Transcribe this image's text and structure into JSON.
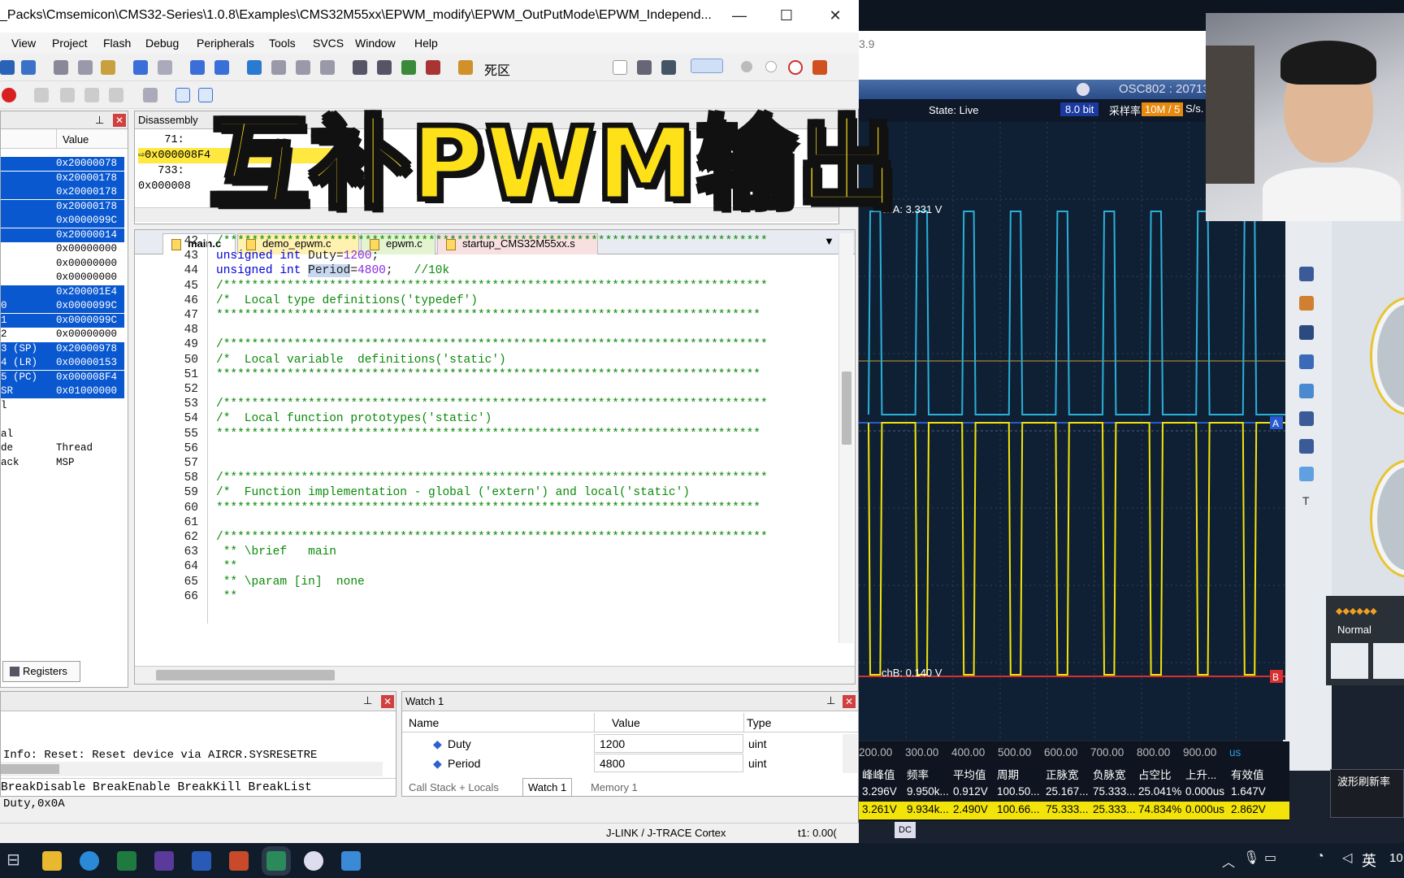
{
  "window": {
    "title": "_Packs\\Cmsemicon\\CMS32-Series\\1.0.8\\Examples\\CMS32M55xx\\EPWM_modify\\EPWM_OutPutMode\\EPWM_Independ...",
    "minimize": "—",
    "maximize": "☐",
    "close": "✕"
  },
  "menu": [
    "View",
    "Project",
    "Flash",
    "Debug",
    "Peripherals",
    "Tools",
    "SVCS",
    "Window",
    "Help"
  ],
  "toolbar": {
    "deadzone_label": "死区"
  },
  "registers": {
    "header_value": "Value",
    "tab_label": "Registers",
    "rows": [
      {
        "name": "",
        "value": "0x20000078",
        "sel": true
      },
      {
        "name": "",
        "value": "0x20000178",
        "sel": true
      },
      {
        "name": "",
        "value": "0x20000178",
        "sel": true
      },
      {
        "name": "",
        "value": "0x20000178",
        "sel": true
      },
      {
        "name": "",
        "value": "0x0000099C",
        "sel": true
      },
      {
        "name": "",
        "value": "0x20000014",
        "sel": true
      },
      {
        "name": "",
        "value": "0x00000000",
        "sel": false
      },
      {
        "name": "",
        "value": "0x00000000",
        "sel": false
      },
      {
        "name": "",
        "value": "0x00000000",
        "sel": false
      },
      {
        "name": "",
        "value": "0x200001E4",
        "sel": true
      },
      {
        "name": "0",
        "value": "0x0000099C",
        "sel": true
      },
      {
        "name": "1",
        "value": "0x0000099C",
        "sel": true
      },
      {
        "name": "2",
        "value": "0x00000000",
        "sel": false
      },
      {
        "name": "3 (SP)",
        "value": "0x20000978",
        "sel": true
      },
      {
        "name": "4 (LR)",
        "value": "0x00000153",
        "sel": true
      },
      {
        "name": "5 (PC)",
        "value": "0x000008F4",
        "sel": true
      },
      {
        "name": "SR",
        "value": "0x01000000",
        "sel": true
      },
      {
        "name": "l",
        "value": "",
        "sel": false
      },
      {
        "name": "",
        "value": "",
        "sel": false
      },
      {
        "name": "al",
        "value": "",
        "sel": false
      },
      {
        "name": "de",
        "value": "Thread",
        "sel": false
      },
      {
        "name": "ack",
        "value": "MSP",
        "sel": false
      }
    ]
  },
  "disassembly": {
    "title": "Disassembly",
    "lines": [
      "    71:",
      "0x000008F4",
      "   733:",
      "0x000008"
    ]
  },
  "editor": {
    "tabs": [
      "main.c",
      "demo_epwm.c",
      "epwm.c",
      "startup_CMS32M55xx.s"
    ],
    "lines": [
      {
        "n": "42",
        "t": "/*****************************************************************************",
        "c": "cm"
      },
      {
        "n": "43",
        "t": "unsigned int Duty=1200;",
        "c": "code"
      },
      {
        "n": "44",
        "t": "unsigned int Period=4800;   //10k",
        "c": "code"
      },
      {
        "n": "45",
        "t": "/*****************************************************************************",
        "c": "cm"
      },
      {
        "n": "46",
        "t": "/*  Local type definitions('typedef')",
        "c": "cm"
      },
      {
        "n": "47",
        "t": "*****************************************************************************",
        "c": "cm"
      },
      {
        "n": "48",
        "t": "",
        "c": "cm"
      },
      {
        "n": "49",
        "t": "/*****************************************************************************",
        "c": "cm"
      },
      {
        "n": "50",
        "t": "/*  Local variable  definitions('static')",
        "c": "cm"
      },
      {
        "n": "51",
        "t": "*****************************************************************************",
        "c": "cm"
      },
      {
        "n": "52",
        "t": "",
        "c": "cm"
      },
      {
        "n": "53",
        "t": "/*****************************************************************************",
        "c": "cm"
      },
      {
        "n": "54",
        "t": "/*  Local function prototypes('static')",
        "c": "cm"
      },
      {
        "n": "55",
        "t": "*****************************************************************************",
        "c": "cm"
      },
      {
        "n": "56",
        "t": "",
        "c": "cm"
      },
      {
        "n": "57",
        "t": "",
        "c": "cm"
      },
      {
        "n": "58",
        "t": "/*****************************************************************************",
        "c": "cm"
      },
      {
        "n": "59",
        "t": "/*  Function implementation - global ('extern') and local('static')",
        "c": "cm"
      },
      {
        "n": "60",
        "t": "*****************************************************************************",
        "c": "cm"
      },
      {
        "n": "61",
        "t": "",
        "c": "cm"
      },
      {
        "n": "62",
        "t": "/*****************************************************************************",
        "c": "cm"
      },
      {
        "n": "63",
        "t": " ** \\brief   main",
        "c": "cm"
      },
      {
        "n": "64",
        "t": " **",
        "c": "cm"
      },
      {
        "n": "65",
        "t": " ** \\param [in]  none",
        "c": "cm"
      },
      {
        "n": "66",
        "t": " **",
        "c": "cm"
      }
    ]
  },
  "command": {
    "line1": "Info: Reset: Reset device via AIRCR.SYSRESETRE",
    "line2": "Duty,0x0A",
    "input": "BreakDisable BreakEnable BreakKill BreakList"
  },
  "watch": {
    "title": "Watch 1",
    "headers": [
      "Name",
      "Value",
      "Type"
    ],
    "rows": [
      {
        "name": "Duty",
        "value": "1200",
        "type": "uint"
      },
      {
        "name": "Period",
        "value": "4800",
        "type": "uint"
      }
    ],
    "tabs": [
      "Call Stack + Locals",
      "Watch 1",
      "Memory 1"
    ]
  },
  "status": {
    "debugger": "J-LINK / J-TRACE Cortex",
    "time": "t1: 0.00("
  },
  "scope": {
    "version": "3.9",
    "title": "OSC802 : 20713",
    "state": "State: Live",
    "bits": "8.0 bit",
    "rate_label": "采样率",
    "rate": "10M / 5",
    "rate_unit": "S/s.",
    "chA": "chA: 3.331 V",
    "chB": "chB: 0.140 V",
    "normal": "Normal",
    "dc": "DC",
    "refresh": "波形刷新率",
    "ch_a_color": "#2ab0d8",
    "ch_b_color": "#f2e40a",
    "xticks": [
      "200.00",
      "300.00",
      "400.00",
      "500.00",
      "600.00",
      "700.00",
      "800.00",
      "900.00",
      "us"
    ],
    "meas_headers": [
      "峰峰值",
      "频率",
      "平均值",
      "周期",
      "正脉宽",
      "负脉宽",
      "占空比",
      "上升...",
      "有效值"
    ],
    "meas_a": [
      "3.296V",
      "9.950k...",
      "0.912V",
      "100.50...",
      "25.167...",
      "75.333...",
      "25.041%",
      "0.000us",
      "1.647V"
    ],
    "meas_b": [
      "3.261V",
      "9.934k...",
      "2.490V",
      "100.66...",
      "75.333...",
      "25.333...",
      "74.834%",
      "0.000us",
      "2.862V"
    ]
  },
  "overlay_title": "互补PWM输出",
  "taskbar": {
    "ime": "英",
    "time": "10"
  }
}
